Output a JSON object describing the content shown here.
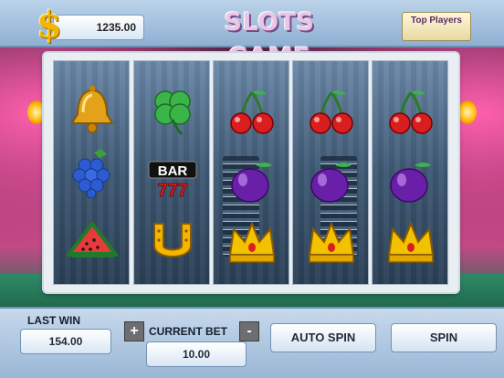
{
  "header": {
    "currency_symbol": "$",
    "balance": "1235.00",
    "title": "SLOTS GAME",
    "top_players_label": "Top Players"
  },
  "reels": [
    {
      "symbols": [
        "bell",
        "grapes",
        "watermelon"
      ]
    },
    {
      "symbols": [
        "clover",
        "bar-777",
        "horseshoe"
      ]
    },
    {
      "symbols": [
        "cherries",
        "plum",
        "crown"
      ]
    },
    {
      "symbols": [
        "cherries",
        "plum",
        "crown"
      ]
    },
    {
      "symbols": [
        "cherries",
        "plum",
        "crown"
      ]
    }
  ],
  "bar_symbol": {
    "top_text": "BAR",
    "bottom_text": "777"
  },
  "footer": {
    "last_win_label": "LAST WIN",
    "last_win_value": "154.00",
    "current_bet_label": "CURRENT BET",
    "current_bet_value": "10.00",
    "increase_label": "+",
    "decrease_label": "-",
    "auto_spin_label": "AUTO SPIN",
    "spin_label": "SPIN"
  },
  "colors": {
    "panel": "#9ab7d6",
    "accent_gold": "#f2b600",
    "title_pink": "#e9c6e6"
  }
}
